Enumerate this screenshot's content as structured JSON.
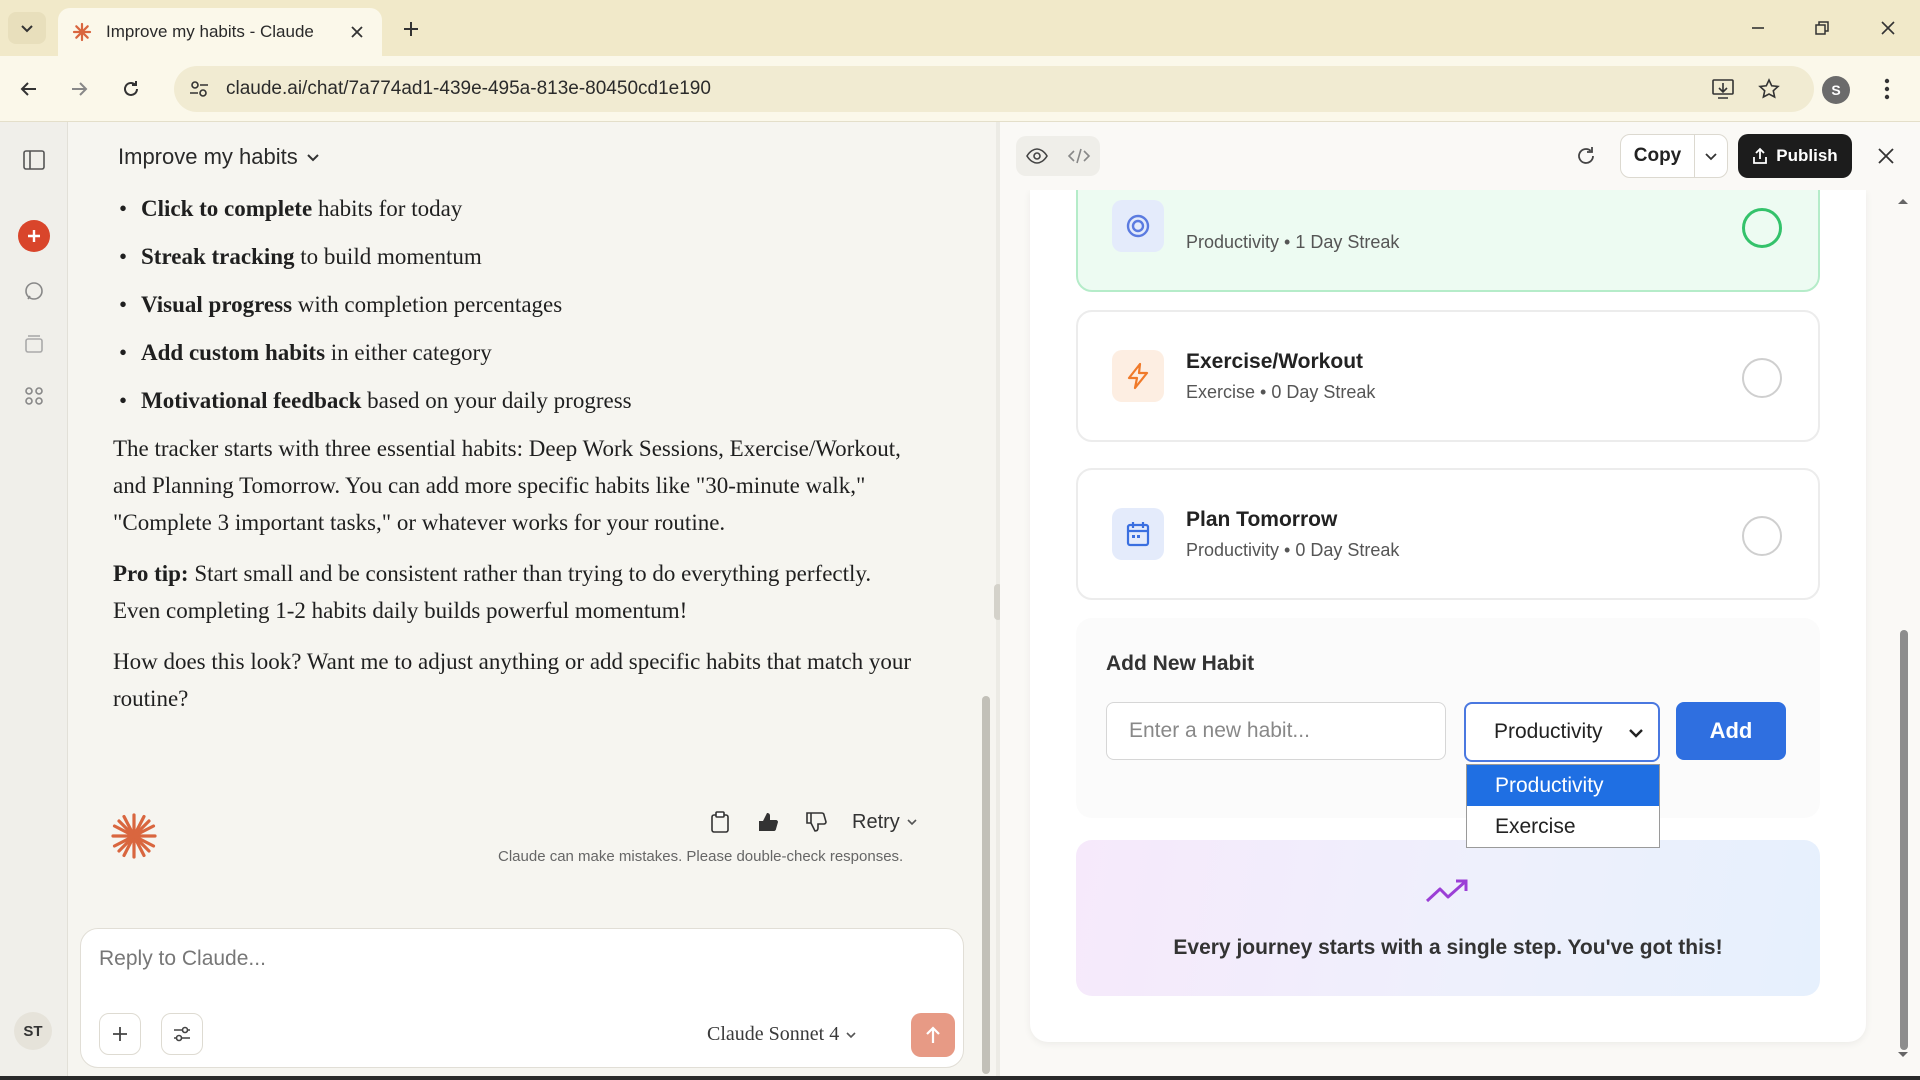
{
  "browser": {
    "tab_title": "Improve my habits - Claude",
    "url": "claude.ai/chat/7a774ad1-439e-495a-813e-80450cd1e190",
    "profile_initial": "S"
  },
  "sidebar": {
    "user_initials": "ST"
  },
  "chat": {
    "title": "Improve my habits",
    "bullets": [
      {
        "bold": "Click to complete",
        "rest": " habits for today"
      },
      {
        "bold": "Streak tracking",
        "rest": " to build momentum"
      },
      {
        "bold": "Visual progress",
        "rest": " with completion percentages"
      },
      {
        "bold": "Add custom habits",
        "rest": " in either category"
      },
      {
        "bold": "Motivational feedback",
        "rest": " based on your daily progress"
      }
    ],
    "paragraph1": "The tracker starts with three essential habits: Deep Work Sessions, Exercise/Workout, and Planning Tomorrow. You can add more specific habits like \"30-minute walk,\" \"Complete 3 important tasks,\" or whatever works for your routine.",
    "pro_tip_label": "Pro tip:",
    "pro_tip_text": " Start small and be consistent rather than trying to do everything perfectly. Even completing 1-2 habits daily builds powerful momentum!",
    "question": "How does this look? Want me to adjust anything or add specific habits that match your routine?",
    "retry_label": "Retry",
    "disclaimer": "Claude can make mistakes. Please double-check responses.",
    "reply_placeholder": "Reply to Claude...",
    "model_label": "Claude Sonnet 4"
  },
  "artifact": {
    "copy_label": "Copy",
    "publish_label": "Publish",
    "habits": [
      {
        "name": "",
        "meta": "Productivity • 1 Day Streak",
        "completed": true,
        "icon": "target-icon",
        "color": "#5b7be0"
      },
      {
        "name": "Exercise/Workout",
        "meta": "Exercise • 0 Day Streak",
        "completed": false,
        "icon": "lightning-icon",
        "color": "#f07a2a"
      },
      {
        "name": "Plan Tomorrow",
        "meta": "Productivity • 0 Day Streak",
        "completed": false,
        "icon": "calendar-icon",
        "color": "#3a6fe0"
      }
    ],
    "add_section": {
      "title": "Add New Habit",
      "input_placeholder": "Enter a new habit...",
      "selected_category": "Productivity",
      "options": [
        "Productivity",
        "Exercise"
      ],
      "add_label": "Add"
    },
    "motivation": "Every journey starts with a single step. You've got this!"
  }
}
